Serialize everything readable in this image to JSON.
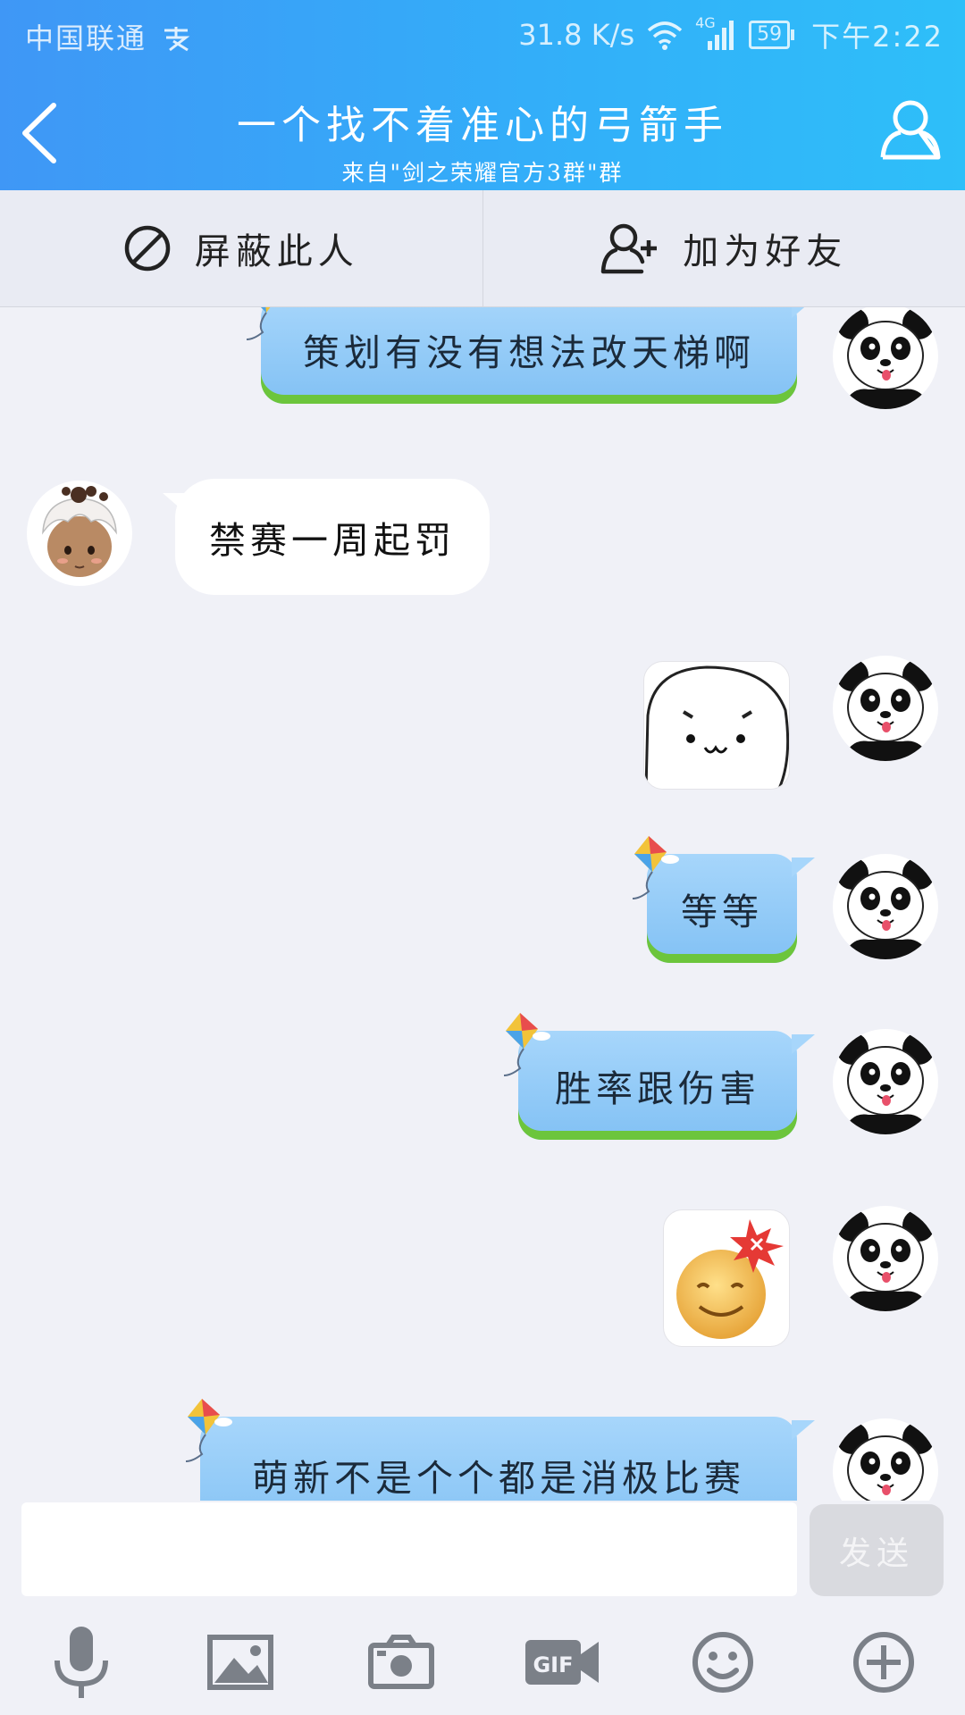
{
  "status_bar": {
    "carrier": "中国联通",
    "speed": "31.8 K/s",
    "network": "4G",
    "battery": "59",
    "time": "下午2:22"
  },
  "header": {
    "title": "一个找不着准心的弓箭手",
    "subtitle": "来自\"剑之荣耀官方3群\"群"
  },
  "actions": {
    "block_label": "屏蔽此人",
    "add_friend_label": "加为好友"
  },
  "messages": [
    {
      "from": "me",
      "type": "text",
      "text": "策划有没有想法改天梯啊"
    },
    {
      "from": "other",
      "type": "text",
      "text": "禁赛一周起罚"
    },
    {
      "from": "me",
      "type": "sticker",
      "sticker": "blob-face-sticker"
    },
    {
      "from": "me",
      "type": "text",
      "text": "等等"
    },
    {
      "from": "me",
      "type": "text",
      "text": "胜率跟伤害"
    },
    {
      "from": "me",
      "type": "sticker",
      "sticker": "angry-smiley-sticker"
    },
    {
      "from": "me",
      "type": "text",
      "text": "萌新不是个个都是消极比赛"
    }
  ],
  "input": {
    "value": "",
    "send_label": "发送"
  },
  "toolbar": [
    "microphone-icon",
    "image-icon",
    "camera-icon",
    "gif-icon",
    "emoji-icon",
    "plus-icon"
  ],
  "colors": {
    "header_start": "#3f97f6",
    "header_end": "#2ebff9",
    "bubble_blue": "#a7d6fb",
    "grass_green": "#6cc53c",
    "background": "#f0f1f7"
  }
}
